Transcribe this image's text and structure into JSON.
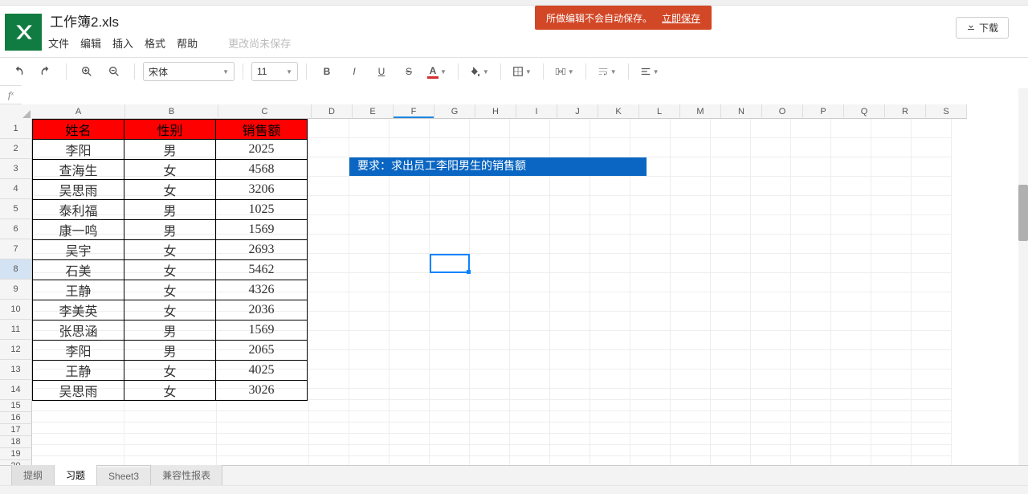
{
  "doc_title": "工作簿2.xls",
  "menu": [
    "文件",
    "编辑",
    "插入",
    "格式",
    "帮助"
  ],
  "save_status": "更改尚未保存",
  "warning": {
    "text": "所做编辑不会自动保存。",
    "link": "立即保存"
  },
  "download_label": "下载",
  "font_name": "宋体",
  "font_size": "11",
  "fx_label": "fˣ",
  "columns": [
    "A",
    "B",
    "C",
    "D",
    "E",
    "F",
    "G",
    "H",
    "I",
    "J",
    "K",
    "L",
    "M",
    "N",
    "O",
    "P",
    "Q",
    "R",
    "S"
  ],
  "selected_cell": "F8",
  "selected_column": "F",
  "selected_row": 8,
  "table": {
    "headers": [
      "姓名",
      "性别",
      "销售额"
    ],
    "rows": [
      [
        "李阳",
        "男",
        "2025"
      ],
      [
        "查海生",
        "女",
        "4568"
      ],
      [
        "吴思雨",
        "女",
        "3206"
      ],
      [
        "泰利福",
        "男",
        "1025"
      ],
      [
        "康一鸣",
        "男",
        "1569"
      ],
      [
        "吴宇",
        "女",
        "2693"
      ],
      [
        "石美",
        "女",
        "5462"
      ],
      [
        "王静",
        "女",
        "4326"
      ],
      [
        "李美英",
        "女",
        "2036"
      ],
      [
        "张思涵",
        "男",
        "1569"
      ],
      [
        "李阳",
        "男",
        "2065"
      ],
      [
        "王静",
        "女",
        "4025"
      ],
      [
        "吴思雨",
        "女",
        "3026"
      ]
    ]
  },
  "instruction": "要求：求出员工李阳男生的销售额",
  "sheets": [
    "提纲",
    "习题",
    "Sheet3",
    "兼容性报表"
  ],
  "active_sheet": 1
}
